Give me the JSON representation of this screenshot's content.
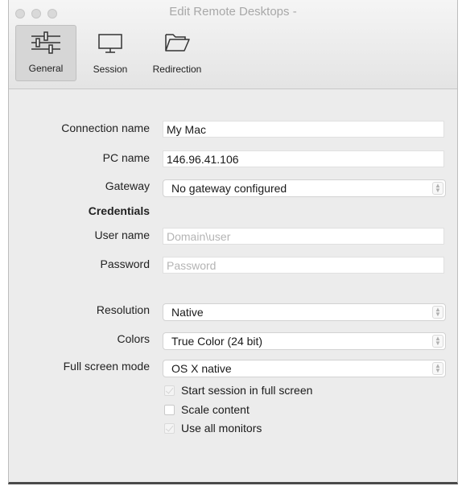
{
  "window": {
    "title": "Edit Remote Desktops -"
  },
  "toolbar": {
    "items": [
      {
        "label": "General",
        "icon": "sliders-icon",
        "selected": true
      },
      {
        "label": "Session",
        "icon": "monitor-icon",
        "selected": false
      },
      {
        "label": "Redirection",
        "icon": "folder-icon",
        "selected": false
      }
    ]
  },
  "form": {
    "connection_name": {
      "label": "Connection name",
      "value": "My Mac"
    },
    "pc_name": {
      "label": "PC name",
      "value": "146.96.41.106"
    },
    "gateway": {
      "label": "Gateway",
      "value": "No gateway configured"
    },
    "credentials_heading": "Credentials",
    "user_name": {
      "label": "User name",
      "value": "",
      "placeholder": "Domain\\user"
    },
    "password": {
      "label": "Password",
      "value": "",
      "placeholder": "Password"
    },
    "resolution": {
      "label": "Resolution",
      "value": "Native"
    },
    "colors": {
      "label": "Colors",
      "value": "True Color (24 bit)"
    },
    "full_screen_mode": {
      "label": "Full screen mode",
      "value": "OS X native"
    },
    "checkboxes": [
      {
        "label": "Start session in full screen",
        "checked": false,
        "disabled": true
      },
      {
        "label": "Scale content",
        "checked": false,
        "disabled": false
      },
      {
        "label": "Use all monitors",
        "checked": false,
        "disabled": true
      }
    ]
  }
}
